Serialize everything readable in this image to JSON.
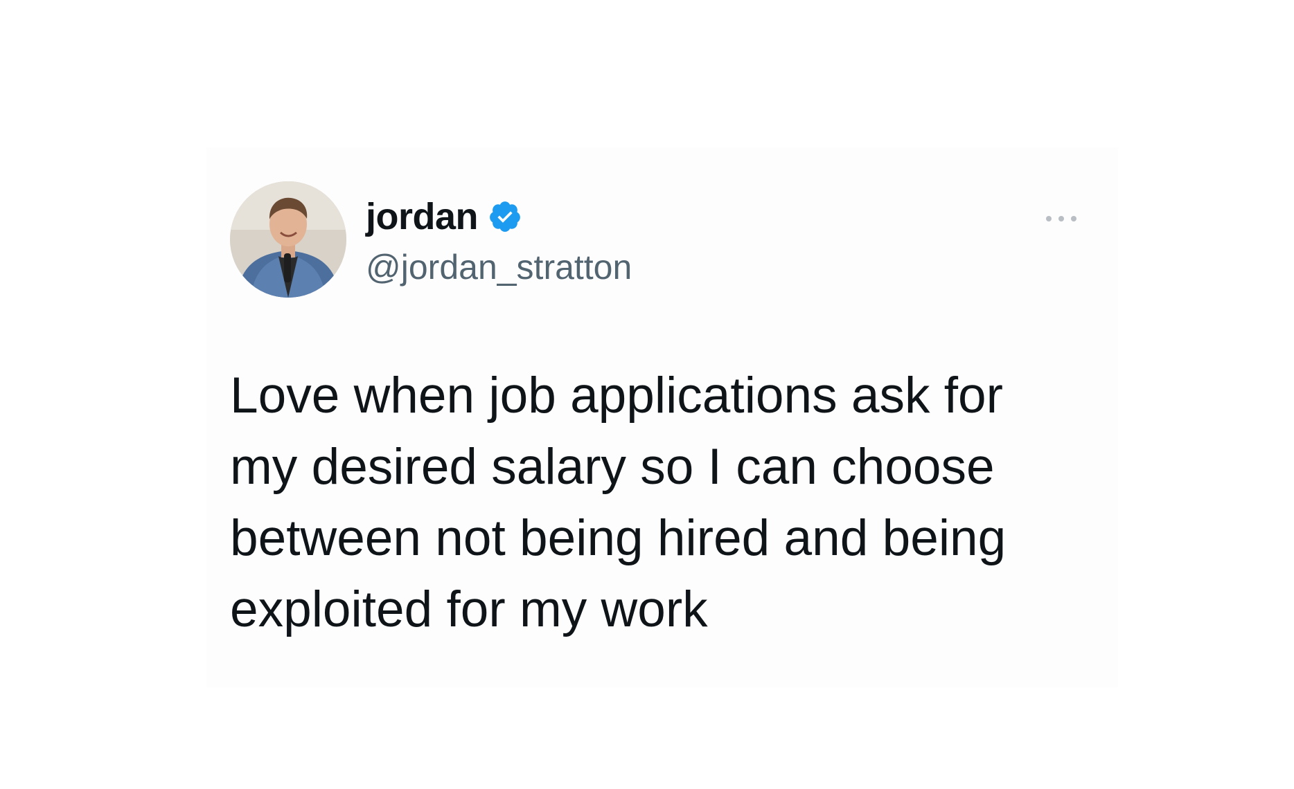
{
  "tweet": {
    "author": {
      "display_name": "jordan",
      "handle": "@jordan_stratton",
      "verified": true,
      "avatar_icon": "avatar-photo"
    },
    "text": "Love when job applications ask for\nmy desired salary so I can choose\nbetween not being hired and being\nexploited for my work",
    "menu_icon": "more-options-icon"
  },
  "colors": {
    "text_primary": "#0f1419",
    "text_secondary": "#536471",
    "verified_blue": "#1d9bf0",
    "card_background": "#fdfdfd"
  }
}
